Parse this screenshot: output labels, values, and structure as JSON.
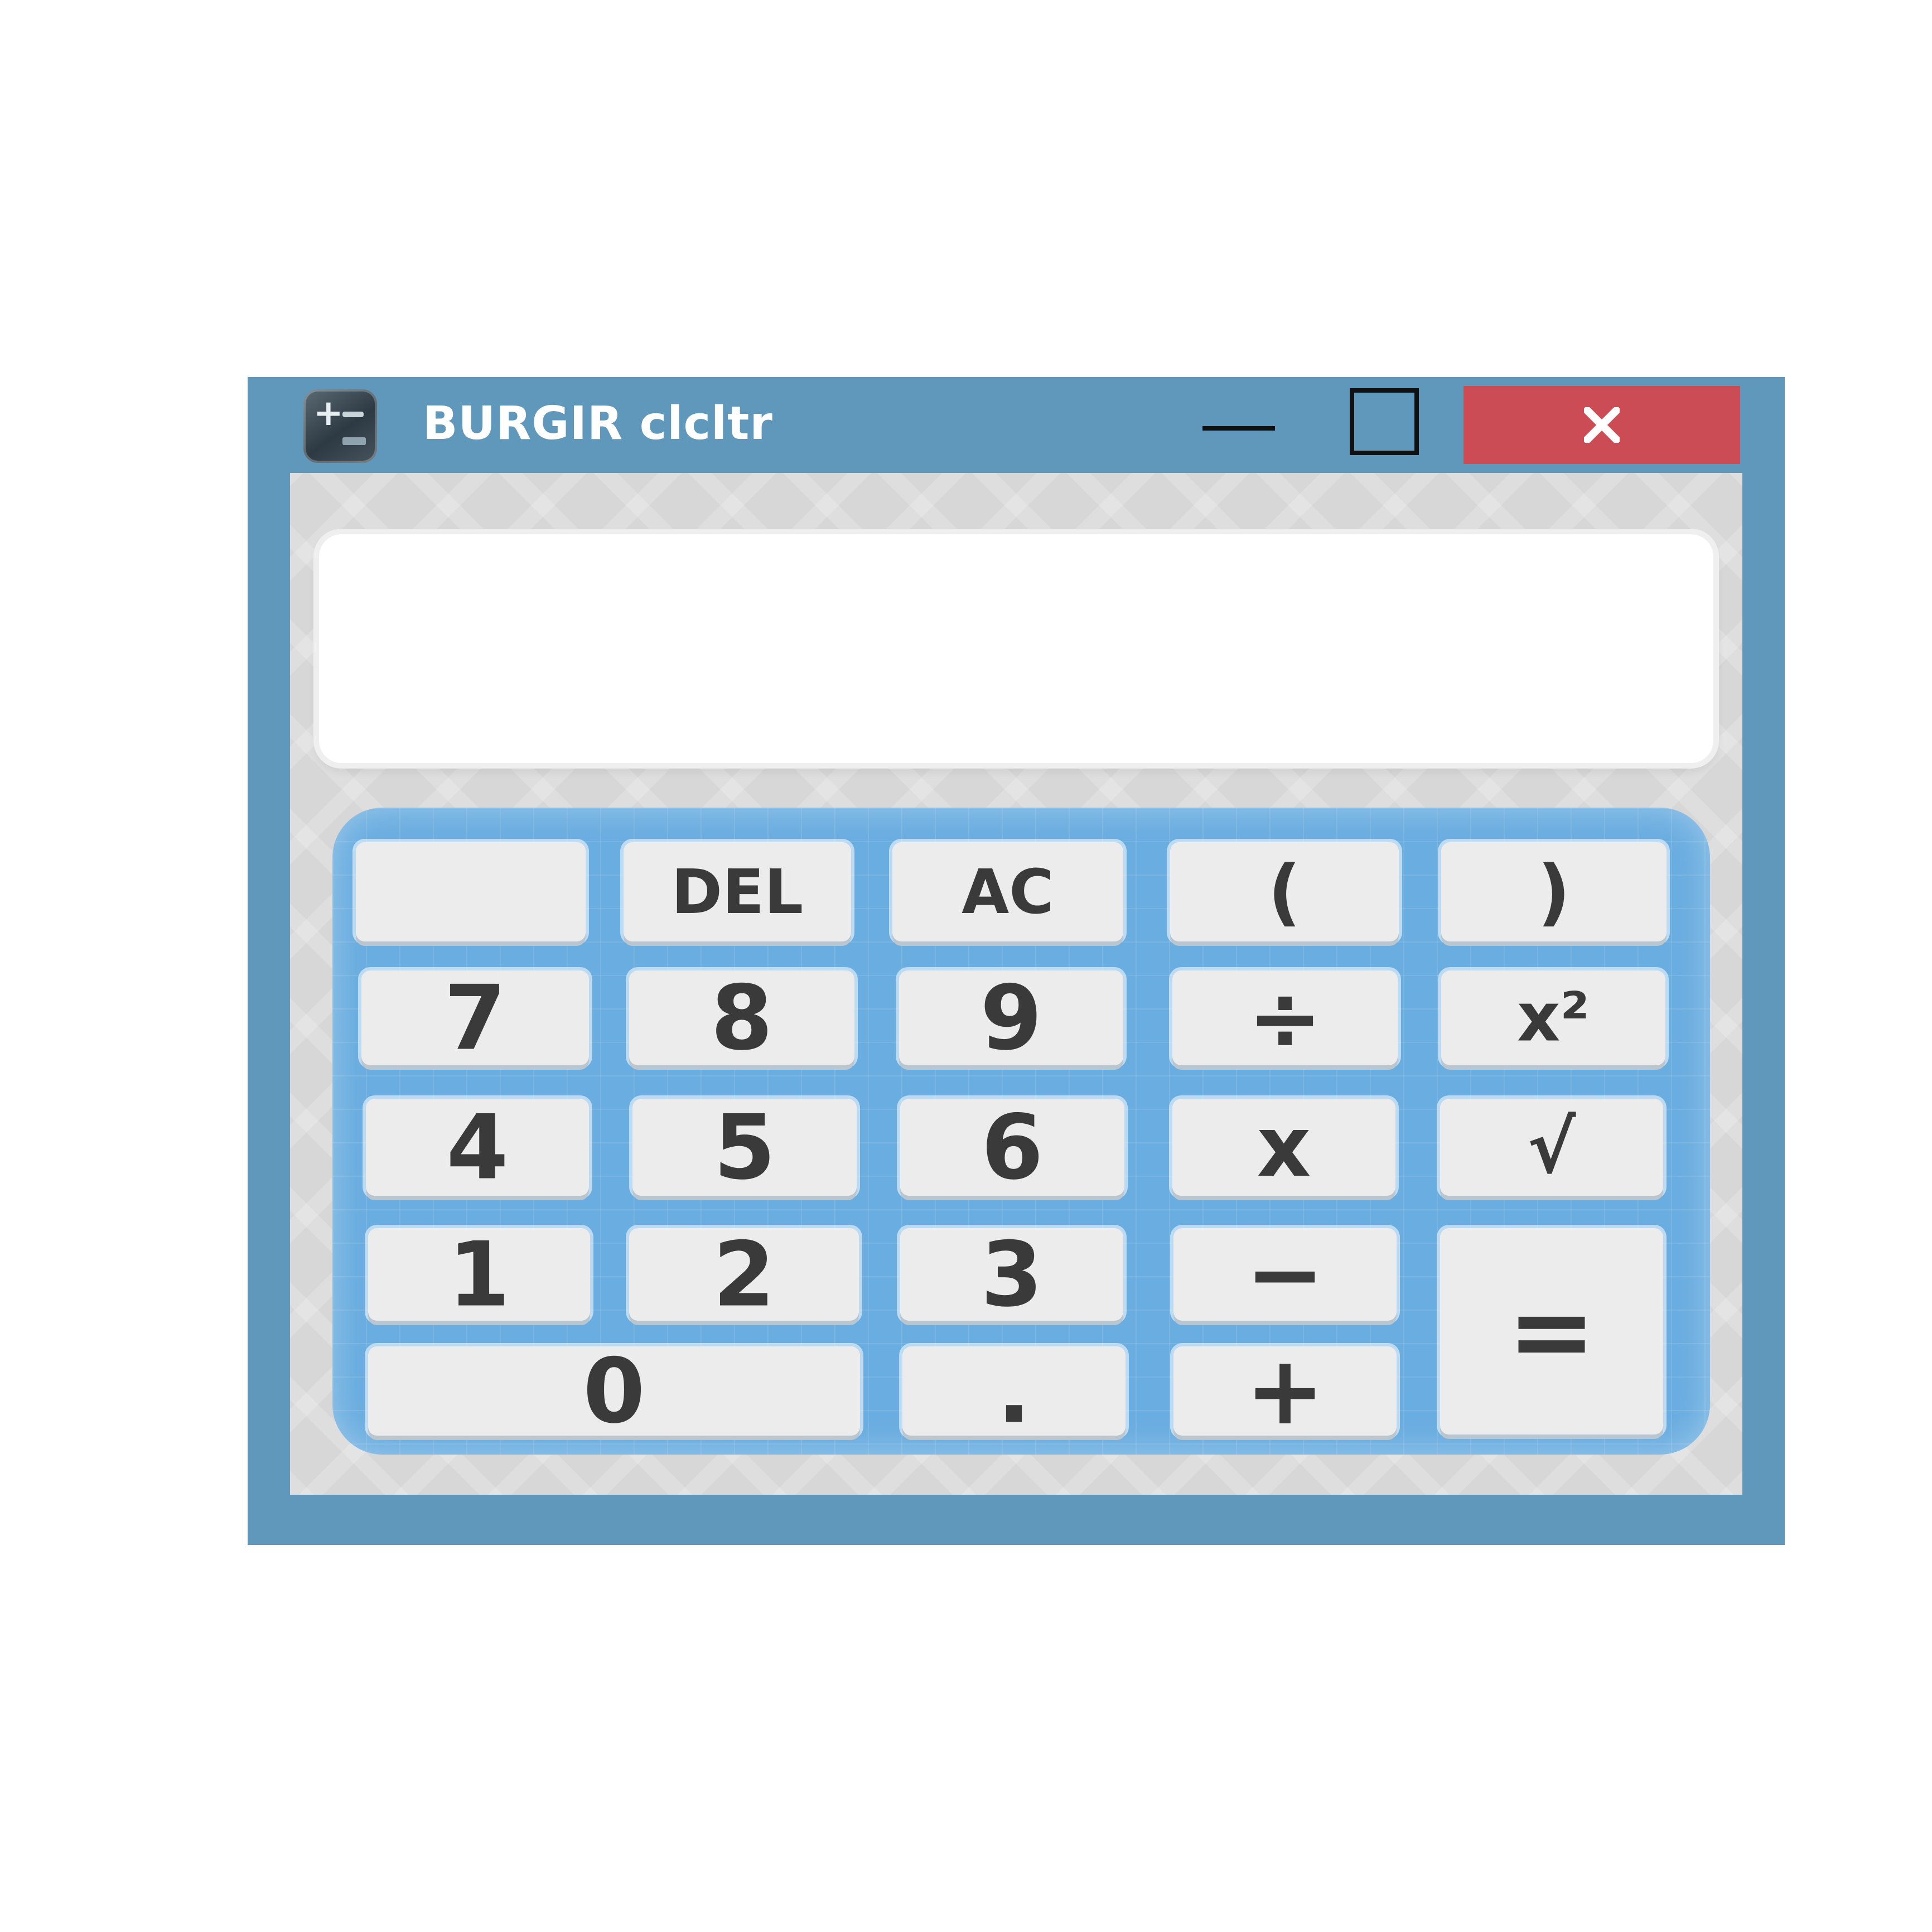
{
  "window": {
    "title": "BURGIR clcltr"
  },
  "display": {
    "value": ""
  },
  "keys": {
    "blank": "",
    "del": "DEL",
    "ac": "AC",
    "open_paren": "(",
    "close_paren": ")",
    "seven": "7",
    "eight": "8",
    "nine": "9",
    "divide": "÷",
    "square": "x²",
    "four": "4",
    "five": "5",
    "six": "6",
    "multiply": "x",
    "sqrt": "√",
    "one": "1",
    "two": "2",
    "three": "3",
    "minus": "−",
    "equals": "=",
    "zero": "0",
    "dot": ".",
    "plus": "+"
  },
  "colors": {
    "frame": "#5f98bb",
    "close_button": "#cc4c55",
    "keypad": "#6aade0",
    "key_face": "#ececec",
    "key_text": "#3a3a3a"
  },
  "icons": {
    "app": "calculator-app-icon",
    "minimize": "minimize-icon",
    "maximize": "maximize-icon",
    "close": "close-icon"
  }
}
